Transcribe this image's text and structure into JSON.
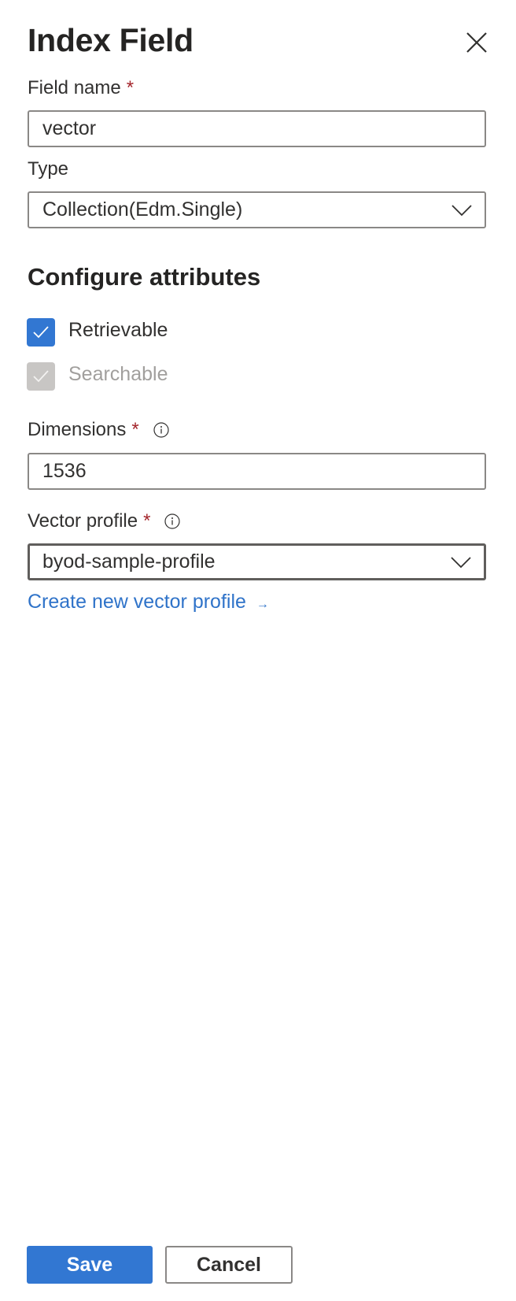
{
  "panel": {
    "title": "Index Field",
    "close_icon": "close-icon"
  },
  "form": {
    "field_name": {
      "label": "Field name",
      "required_marker": "*",
      "value": "vector"
    },
    "type": {
      "label": "Type",
      "selected": "Collection(Edm.Single)",
      "icon": "chevron-down-icon"
    },
    "attributes": {
      "heading": "Configure attributes",
      "items": [
        {
          "label": "Retrievable",
          "checked": true,
          "disabled": false
        },
        {
          "label": "Searchable",
          "checked": true,
          "disabled": true
        }
      ]
    },
    "dimensions": {
      "label": "Dimensions",
      "required_marker": "*",
      "info_icon": "info-icon",
      "value": "1536"
    },
    "vector_profile": {
      "label": "Vector profile",
      "required_marker": "*",
      "info_icon": "info-icon",
      "selected": "byod-sample-profile",
      "icon": "chevron-down-icon"
    },
    "create_link": {
      "label": "Create new vector profile",
      "arrow": "→"
    }
  },
  "footer": {
    "save_label": "Save",
    "cancel_label": "Cancel"
  },
  "colors": {
    "accent": "#3277d2",
    "required": "#a4262c",
    "link": "#2f73c9",
    "disabled": "#c8c6c4"
  }
}
